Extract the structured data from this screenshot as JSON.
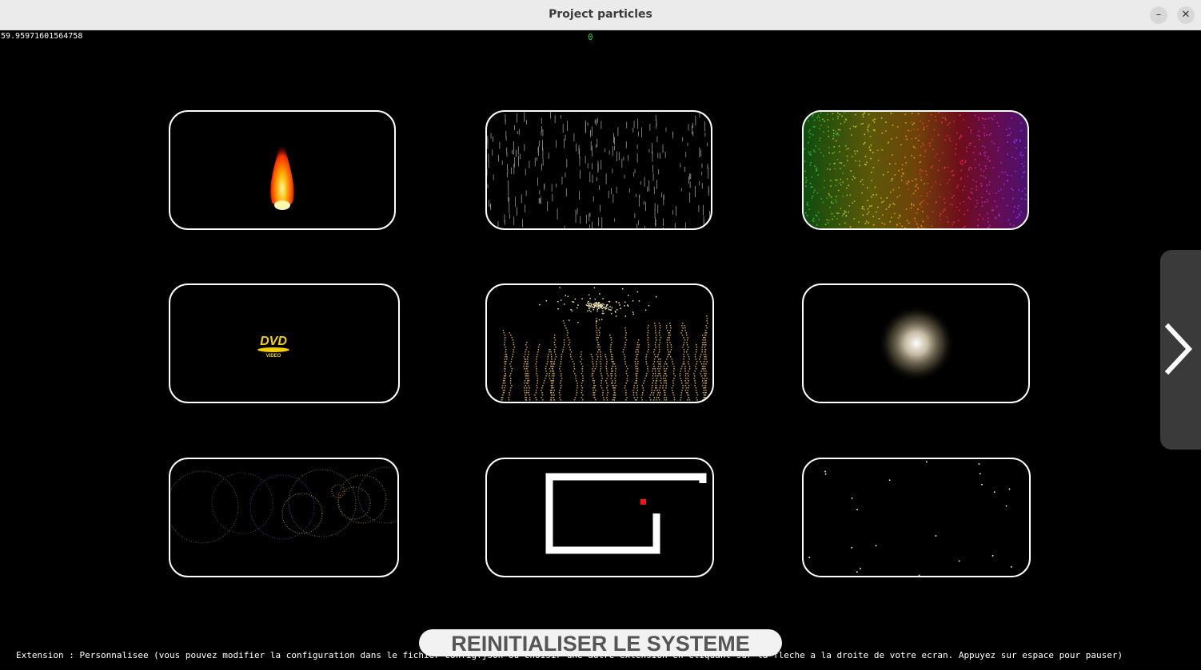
{
  "window": {
    "title": "Project particles"
  },
  "hud": {
    "fps": "59.95971601564758",
    "counter": "0"
  },
  "tiles": [
    {
      "name": "fire-simulation"
    },
    {
      "name": "rain-simulation"
    },
    {
      "name": "rainbow-particles"
    },
    {
      "name": "dvd-logo-bounce",
      "logo_text": "DVD",
      "logo_sub": "VIDEO"
    },
    {
      "name": "golden-particle-growth"
    },
    {
      "name": "glowing-orb"
    },
    {
      "name": "orbit-circles"
    },
    {
      "name": "snake-game"
    },
    {
      "name": "starfield"
    }
  ],
  "footer": {
    "reset_label": "REINITIALISER LE SYSTEME",
    "status_text": "Extension : Personnalisee (vous pouvez modifier la configuration dans le fichier config.json ou choisir une autre extension en cliquant sur la fleche a la droite de votre ecran. Appuyez sur espace pour pauser)"
  },
  "colors": {
    "background": "#000000",
    "tile_border": "#ffffff",
    "counter": "#29d629",
    "button": "#f2f2f2"
  },
  "icons": {
    "minimize": "minimize-icon",
    "close": "close-icon",
    "next": "chevron-right-icon"
  }
}
